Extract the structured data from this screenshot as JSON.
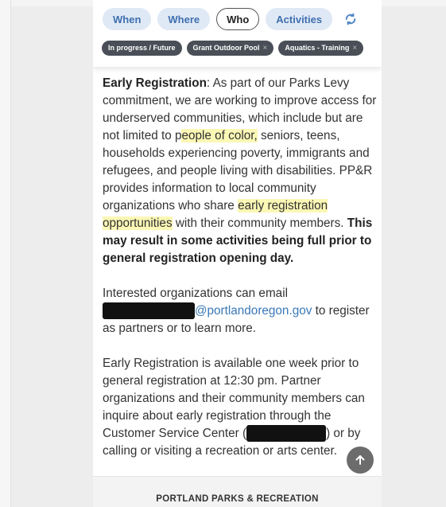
{
  "tabs": [
    {
      "label": "When"
    },
    {
      "label": "Where"
    },
    {
      "label": "Who"
    },
    {
      "label": "Activities"
    }
  ],
  "active_tab": "Who",
  "chips": [
    {
      "label": "In progress / Future"
    },
    {
      "label": "Grant Outdoor Pool"
    },
    {
      "label": "Aquatics - Training"
    }
  ],
  "chip_remove_glyph": "×",
  "para1": {
    "lead": "Early Registration",
    "t1": ": As part of our Parks Levy commitment, we are working to improve access for underserved communities, which include but are not limited to p",
    "h1": "eople of color,",
    "t2": " seniors, teens, households experiencing poverty, immigrants and refugees, and people living with disabilities. PP&R provides information to local community organizations who share ",
    "h2": "early registration",
    "t3": " ",
    "h3": "opportunities",
    "t4": " with their community members. ",
    "bold": "This may result in some activities being full prior to general registration opening day."
  },
  "para2": {
    "t1": "Interested organizations can email ",
    "email_domain": "@portlandoregon.gov",
    "t2": " to register as partners or to learn more."
  },
  "para3": {
    "t1": "Early Registration is available one week prior to general registration at 12:30 pm. Partner organizations and their community members can inquire about early registration through the Customer Service Center (",
    "t2": ") or by calling or visiting a recreation or arts center."
  },
  "footer": {
    "title": "PORTLAND PARKS & RECREATION"
  },
  "colors": {
    "tab_bg": "#dfe9f6",
    "tab_text": "#3f6fae",
    "chip_bg": "#4a4f57",
    "highlight": "#fbf7b5",
    "link": "#3a78b8"
  },
  "icons": {
    "refresh": "refresh-icon",
    "scroll_top": "arrow-up-icon",
    "remove": "close-icon"
  }
}
